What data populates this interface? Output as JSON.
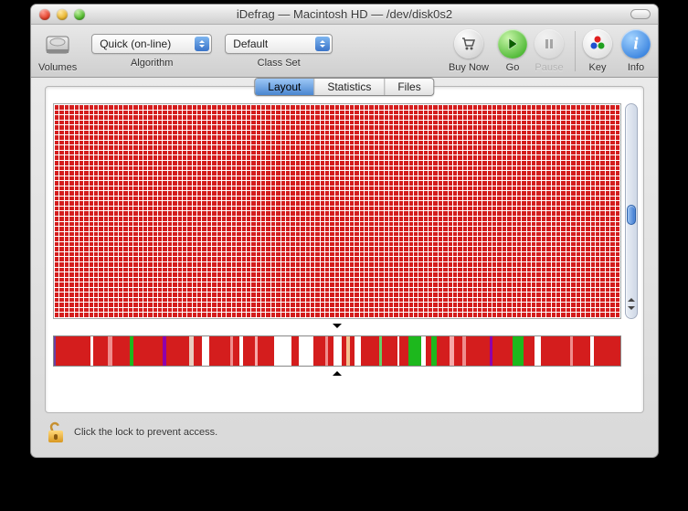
{
  "window": {
    "title": "iDefrag — Macintosh HD — /dev/disk0s2"
  },
  "toolbar": {
    "volumes_label": "Volumes",
    "algorithm_label": "Algorithm",
    "classset_label": "Class Set",
    "buynow_label": "Buy Now",
    "go_label": "Go",
    "pause_label": "Pause",
    "key_label": "Key",
    "info_label": "Info",
    "algorithm_value": "Quick (on-line)",
    "classset_value": "Default"
  },
  "tabs": {
    "items": [
      "Layout",
      "Statistics",
      "Files"
    ],
    "active": "Layout"
  },
  "grid": {
    "cols": 115,
    "rows": 42
  },
  "strips": [
    {
      "c": "#6a3fa3",
      "w": 0.3
    },
    {
      "c": "#d41d1d",
      "w": 6
    },
    {
      "c": "#fff",
      "w": 0.4
    },
    {
      "c": "#d41d1d",
      "w": 2.5
    },
    {
      "c": "#ef8d8d",
      "w": 0.8
    },
    {
      "c": "#d41d1d",
      "w": 3
    },
    {
      "c": "#1db81d",
      "w": 0.6
    },
    {
      "c": "#d41d1d",
      "w": 5
    },
    {
      "c": "#8f00aa",
      "w": 0.5
    },
    {
      "c": "#d41d1d",
      "w": 4
    },
    {
      "c": "#e8cdbf",
      "w": 0.7
    },
    {
      "c": "#d41d1d",
      "w": 1.5
    },
    {
      "c": "#fff",
      "w": 1.2
    },
    {
      "c": "#d41d1d",
      "w": 3.5
    },
    {
      "c": "#ef8d8d",
      "w": 0.6
    },
    {
      "c": "#d41d1d",
      "w": 1
    },
    {
      "c": "#fff",
      "w": 0.6
    },
    {
      "c": "#d41d1d",
      "w": 2
    },
    {
      "c": "#f6a8a8",
      "w": 0.5
    },
    {
      "c": "#d41d1d",
      "w": 2.8
    },
    {
      "c": "#fff",
      "w": 3
    },
    {
      "c": "#d41d1d",
      "w": 1.2
    },
    {
      "c": "#fff",
      "w": 2.5
    },
    {
      "c": "#d41d1d",
      "w": 2
    },
    {
      "c": "#ef8d8d",
      "w": 0.5
    },
    {
      "c": "#d41d1d",
      "w": 1
    },
    {
      "c": "#fff",
      "w": 1.4
    },
    {
      "c": "#d41d1d",
      "w": 0.8
    },
    {
      "c": "#f4c090",
      "w": 0.5
    },
    {
      "c": "#d41d1d",
      "w": 0.8
    },
    {
      "c": "#fff",
      "w": 1.2
    },
    {
      "c": "#d41d1d",
      "w": 3
    },
    {
      "c": "#67d067",
      "w": 0.6
    },
    {
      "c": "#d41d1d",
      "w": 2.5
    },
    {
      "c": "#fff",
      "w": 0.4
    },
    {
      "c": "#d41d1d",
      "w": 1.5
    },
    {
      "c": "#1db81d",
      "w": 2.2
    },
    {
      "c": "#fff",
      "w": 0.8
    },
    {
      "c": "#d41d1d",
      "w": 1
    },
    {
      "c": "#1db81d",
      "w": 0.9
    },
    {
      "c": "#d41d1d",
      "w": 2.2
    },
    {
      "c": "#f6a8a8",
      "w": 0.7
    },
    {
      "c": "#d41d1d",
      "w": 1.5
    },
    {
      "c": "#ef8d8d",
      "w": 0.6
    },
    {
      "c": "#d41d1d",
      "w": 4
    },
    {
      "c": "#8f00aa",
      "w": 0.4
    },
    {
      "c": "#d41d1d",
      "w": 3.5
    },
    {
      "c": "#1db81d",
      "w": 1.8
    },
    {
      "c": "#d41d1d",
      "w": 2
    },
    {
      "c": "#fff",
      "w": 1
    },
    {
      "c": "#d41d1d",
      "w": 5
    },
    {
      "c": "#ef8d8d",
      "w": 0.5
    },
    {
      "c": "#d41d1d",
      "w": 3
    },
    {
      "c": "#fff",
      "w": 0.5
    },
    {
      "c": "#d41d1d",
      "w": 4.5
    }
  ],
  "footer": {
    "lock_text": "Click the lock to prevent access."
  }
}
